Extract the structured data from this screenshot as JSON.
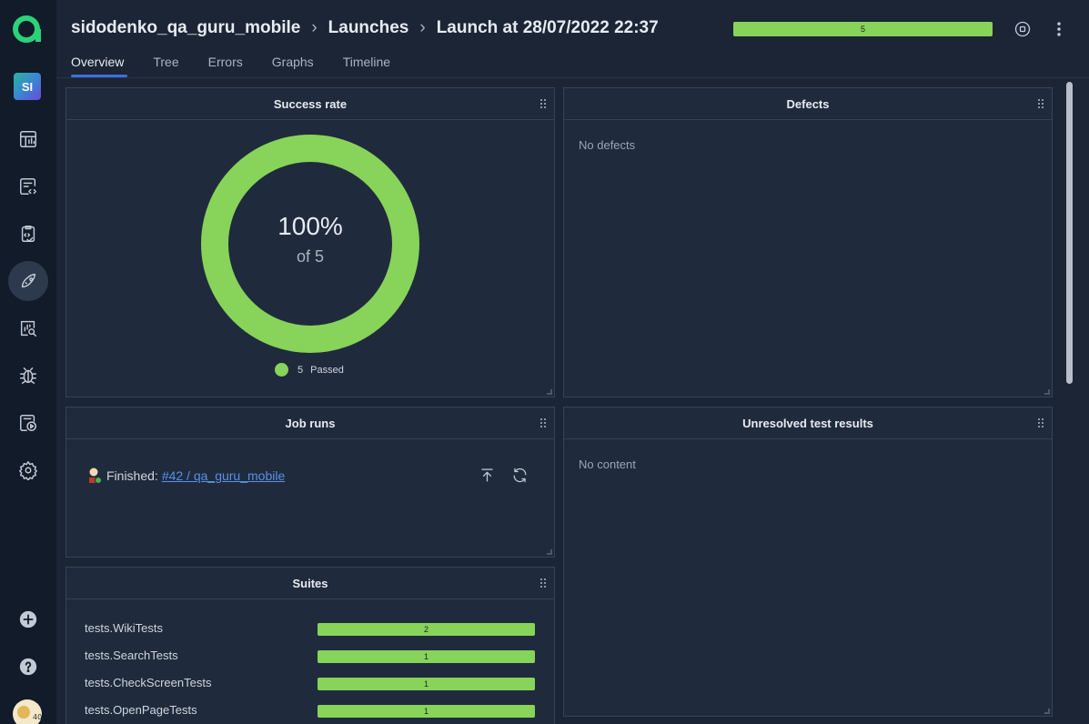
{
  "sidebar": {
    "project_initials": "SI",
    "nav_items": [
      {
        "name": "dashboards-icon"
      },
      {
        "name": "test-cases-icon"
      },
      {
        "name": "test-plans-icon"
      },
      {
        "name": "launches-icon",
        "active": true
      },
      {
        "name": "analytics-icon"
      },
      {
        "name": "defects-icon"
      },
      {
        "name": "jobs-icon"
      },
      {
        "name": "settings-icon"
      }
    ],
    "user_badge": "40"
  },
  "header": {
    "breadcrumb": [
      "sidodenko_qa_guru_mobile",
      "Launches",
      "Launch at 28/07/2022 22:37"
    ],
    "progress_label": "5",
    "tabs": [
      "Overview",
      "Tree",
      "Errors",
      "Graphs",
      "Timeline"
    ],
    "active_tab": "Overview"
  },
  "widgets": {
    "success_rate": {
      "title": "Success rate",
      "percent": "100%",
      "of_label": "of 5",
      "legend_count": "5",
      "legend_label": "Passed",
      "color": "#88d35a"
    },
    "defects": {
      "title": "Defects",
      "empty": "No defects"
    },
    "job_runs": {
      "title": "Job runs",
      "status_label": "Finished:",
      "link_text": "#42 / qa_guru_mobile"
    },
    "unresolved": {
      "title": "Unresolved test results",
      "empty": "No content"
    },
    "suites": {
      "title": "Suites",
      "rows": [
        {
          "name": "tests.WikiTests",
          "count": "2"
        },
        {
          "name": "tests.SearchTests",
          "count": "1"
        },
        {
          "name": "tests.CheckScreenTests",
          "count": "1"
        },
        {
          "name": "tests.OpenPageTests",
          "count": "1"
        }
      ]
    }
  },
  "colors": {
    "passed": "#88d35a",
    "accent": "#3f6fd9",
    "link": "#5a8fe8"
  }
}
